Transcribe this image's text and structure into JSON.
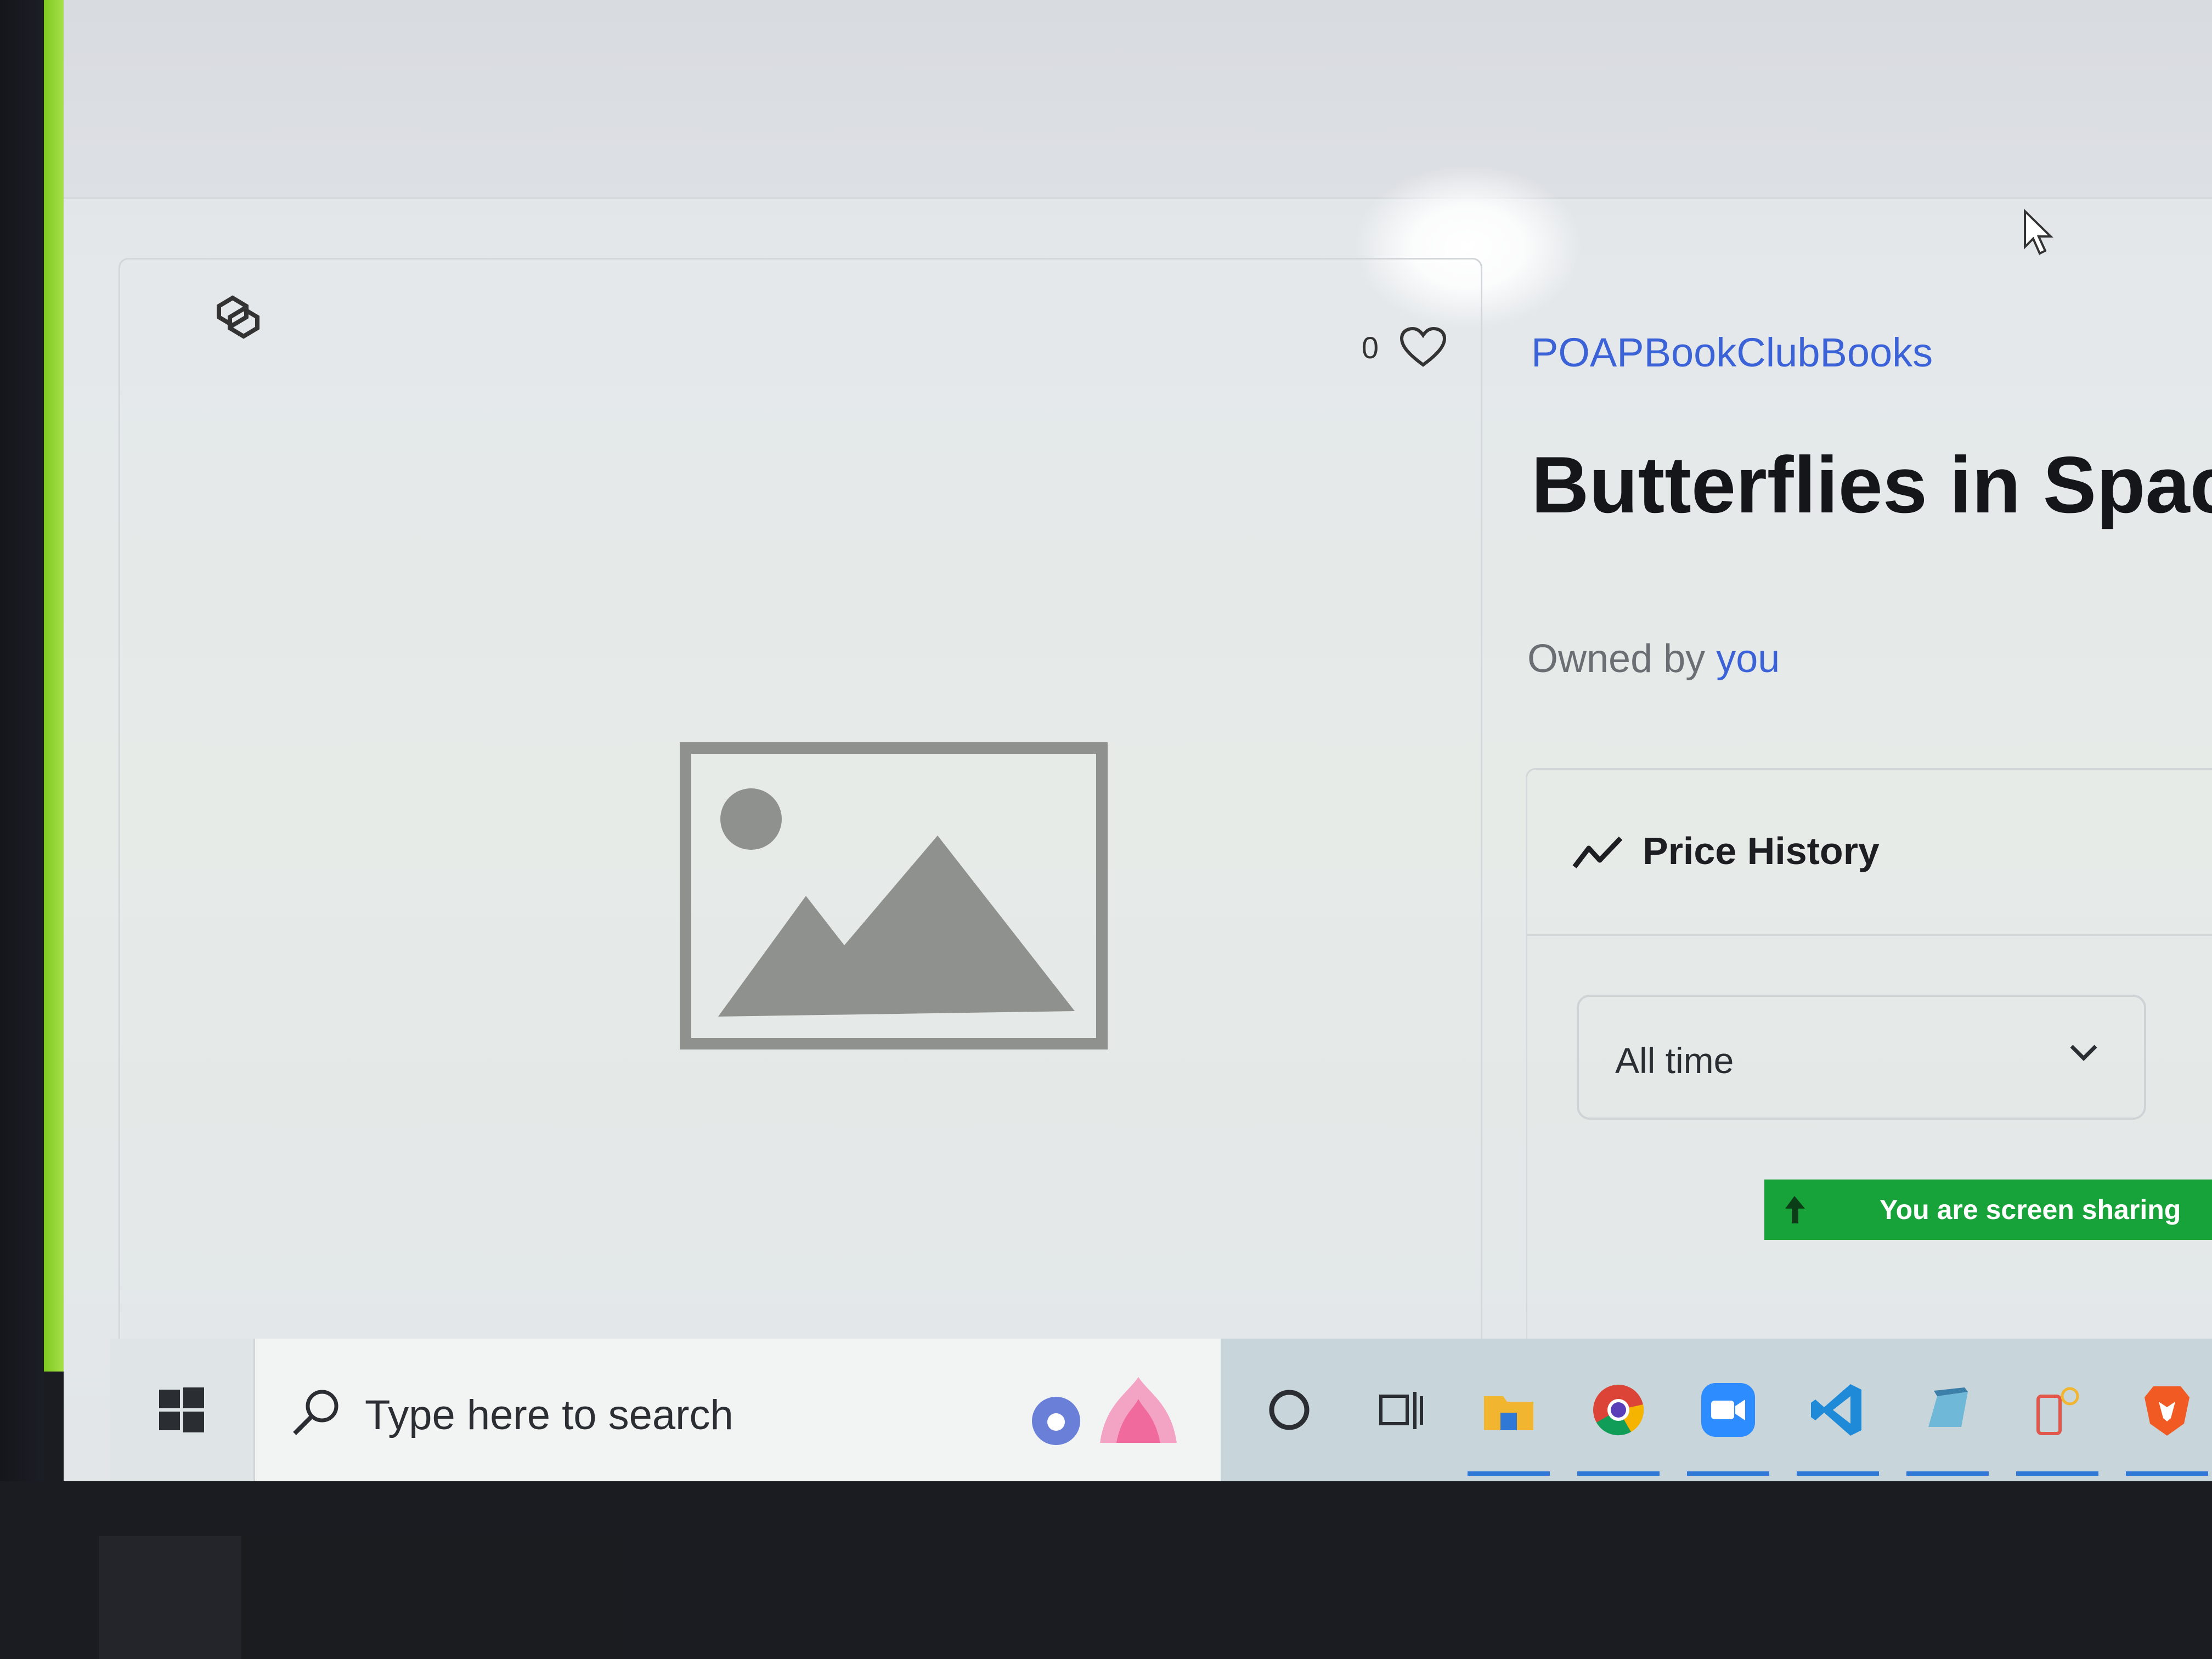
{
  "nft": {
    "collection": "POAPBookClubBooks",
    "title": "Butterflies in Space:",
    "owned_by_prefix": "Owned by",
    "owner": "you",
    "likes": "0"
  },
  "price_history": {
    "title": "Price History",
    "range": "All time"
  },
  "screen_share": {
    "text": "You are screen sharing",
    "color": "#17a23a"
  },
  "taskbar": {
    "search_placeholder": "Type here to search",
    "pinned_icons": [
      "cortana-icon",
      "task-view-icon",
      "file-explorer-icon",
      "chrome-icon",
      "zoom-icon",
      "vscode-icon",
      "app-icon",
      "app-icon",
      "brave-icon"
    ]
  },
  "colors": {
    "link": "#3b62d6",
    "title": "#14161a"
  }
}
